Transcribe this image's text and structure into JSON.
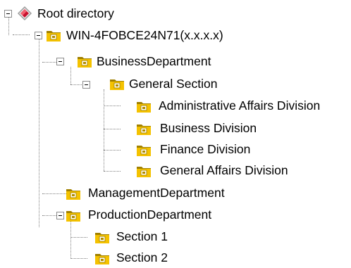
{
  "tree": {
    "root": {
      "label": "Root directory",
      "icon": "root-diamond-icon",
      "expanded": true
    },
    "nodes": [
      {
        "label": "WIN-4FOBCE24N71(x.x.x.x)",
        "icon": "folder-icon",
        "expanded": true
      },
      {
        "label": "BusinessDepartment",
        "icon": "folder-icon",
        "expanded": true
      },
      {
        "label": "General Section",
        "icon": "folder-icon",
        "expanded": true
      },
      {
        "label": "Administrative Affairs Division",
        "icon": "folder-icon"
      },
      {
        "label": "Business Division",
        "icon": "folder-icon"
      },
      {
        "label": "Finance Division",
        "icon": "folder-icon"
      },
      {
        "label": "General Affairs Division",
        "icon": "folder-icon"
      },
      {
        "label": "ManagementDepartment",
        "icon": "folder-icon"
      },
      {
        "label": "ProductionDepartment",
        "icon": "folder-icon",
        "expanded": true
      },
      {
        "label": "Section 1",
        "icon": "folder-icon"
      },
      {
        "label": "Section 2",
        "icon": "folder-icon"
      }
    ]
  },
  "colors": {
    "folder_fill": "#f4c200",
    "folder_dark": "#a08000",
    "folder_icon_box": "#b08c00",
    "root_red": "#c8102e",
    "connector": "#808080"
  }
}
